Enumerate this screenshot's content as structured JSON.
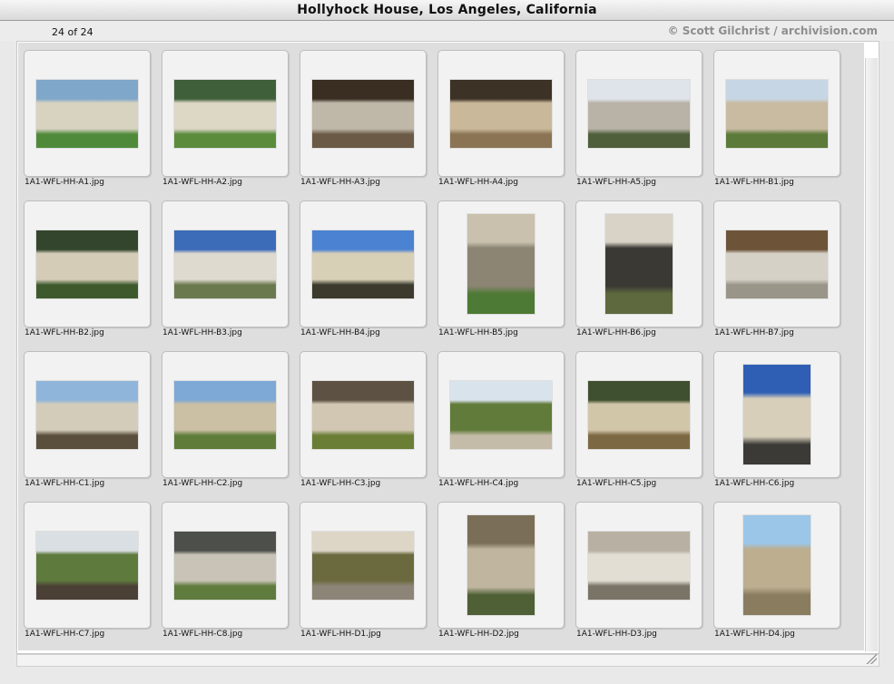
{
  "window": {
    "title": "Hollyhock House, Los Angeles, California"
  },
  "header": {
    "count": "24 of 24",
    "copyright": "© Scott Gilchrist / archivision.com"
  },
  "thumbnails": [
    {
      "filename": "1A1-WFL-HH-A1.jpg",
      "orientation": "landscape",
      "colors": [
        "#7fa7c9",
        "#d8d2c1",
        "#4f8a3a"
      ]
    },
    {
      "filename": "1A1-WFL-HH-A2.jpg",
      "orientation": "landscape",
      "colors": [
        "#3f5f3a",
        "#ddd7c6",
        "#5a8c3c"
      ]
    },
    {
      "filename": "1A1-WFL-HH-A3.jpg",
      "orientation": "landscape",
      "colors": [
        "#3a2e23",
        "#bfb8a8",
        "#6a5a46"
      ]
    },
    {
      "filename": "1A1-WFL-HH-A4.jpg",
      "orientation": "landscape",
      "colors": [
        "#3c3226",
        "#c9b89a",
        "#8b7454"
      ]
    },
    {
      "filename": "1A1-WFL-HH-A5.jpg",
      "orientation": "landscape",
      "colors": [
        "#dfe4ea",
        "#b9b3a7",
        "#4f5f3b"
      ]
    },
    {
      "filename": "1A1-WFL-HH-B1.jpg",
      "orientation": "landscape",
      "colors": [
        "#c7d6e4",
        "#c9bba2",
        "#5c7a39"
      ]
    },
    {
      "filename": "1A1-WFL-HH-B2.jpg",
      "orientation": "landscape",
      "colors": [
        "#33452c",
        "#d5ccb8",
        "#3e5a2d"
      ]
    },
    {
      "filename": "1A1-WFL-HH-B3.jpg",
      "orientation": "landscape",
      "colors": [
        "#3c6bb8",
        "#dfdad0",
        "#6b7a4e"
      ]
    },
    {
      "filename": "1A1-WFL-HH-B4.jpg",
      "orientation": "landscape",
      "colors": [
        "#4b82d2",
        "#d8cfb7",
        "#3b3a2c"
      ]
    },
    {
      "filename": "1A1-WFL-HH-B5.jpg",
      "orientation": "portrait",
      "colors": [
        "#c9c1ad",
        "#8d8574",
        "#4d7a34"
      ]
    },
    {
      "filename": "1A1-WFL-HH-B6.jpg",
      "orientation": "portrait",
      "colors": [
        "#d8d3c6",
        "#3a3934",
        "#5e6a3e"
      ]
    },
    {
      "filename": "1A1-WFL-HH-B7.jpg",
      "orientation": "landscape",
      "colors": [
        "#6d5338",
        "#d6d1c7",
        "#9a9589"
      ]
    },
    {
      "filename": "1A1-WFL-HH-C1.jpg",
      "orientation": "landscape",
      "colors": [
        "#8fb6da",
        "#d4ccbb",
        "#5a4f3c"
      ]
    },
    {
      "filename": "1A1-WFL-HH-C2.jpg",
      "orientation": "landscape",
      "colors": [
        "#7ea8d5",
        "#cbbfa4",
        "#5f7d38"
      ]
    },
    {
      "filename": "1A1-WFL-HH-C3.jpg",
      "orientation": "landscape",
      "colors": [
        "#5c5142",
        "#d1c7b2",
        "#6a7e35"
      ]
    },
    {
      "filename": "1A1-WFL-HH-C4.jpg",
      "orientation": "landscape",
      "colors": [
        "#d9e3ec",
        "#617b3a",
        "#c4bba8"
      ]
    },
    {
      "filename": "1A1-WFL-HH-C5.jpg",
      "orientation": "landscape",
      "colors": [
        "#3f5030",
        "#d2c6a9",
        "#7c6944"
      ]
    },
    {
      "filename": "1A1-WFL-HH-C6.jpg",
      "orientation": "portrait",
      "colors": [
        "#2f5fb5",
        "#d7cfba",
        "#3b3a36"
      ]
    },
    {
      "filename": "1A1-WFL-HH-C7.jpg",
      "orientation": "landscape",
      "colors": [
        "#d9dfe3",
        "#5e7a3d",
        "#4b4036"
      ]
    },
    {
      "filename": "1A1-WFL-HH-C8.jpg",
      "orientation": "landscape",
      "colors": [
        "#4c4f4a",
        "#c8c3b6",
        "#5f7b3e"
      ]
    },
    {
      "filename": "1A1-WFL-HH-D1.jpg",
      "orientation": "landscape",
      "colors": [
        "#ddd6c7",
        "#6b6a3f",
        "#8c8577"
      ]
    },
    {
      "filename": "1A1-WFL-HH-D2.jpg",
      "orientation": "portrait",
      "colors": [
        "#7a6e58",
        "#c0b6a0",
        "#4f5f36"
      ]
    },
    {
      "filename": "1A1-WFL-HH-D3.jpg",
      "orientation": "landscape",
      "colors": [
        "#b8b1a3",
        "#e3ded3",
        "#7a7467"
      ]
    },
    {
      "filename": "1A1-WFL-HH-D4.jpg",
      "orientation": "portrait",
      "colors": [
        "#9cc6e8",
        "#bcae8f",
        "#8a7c5f"
      ]
    }
  ]
}
